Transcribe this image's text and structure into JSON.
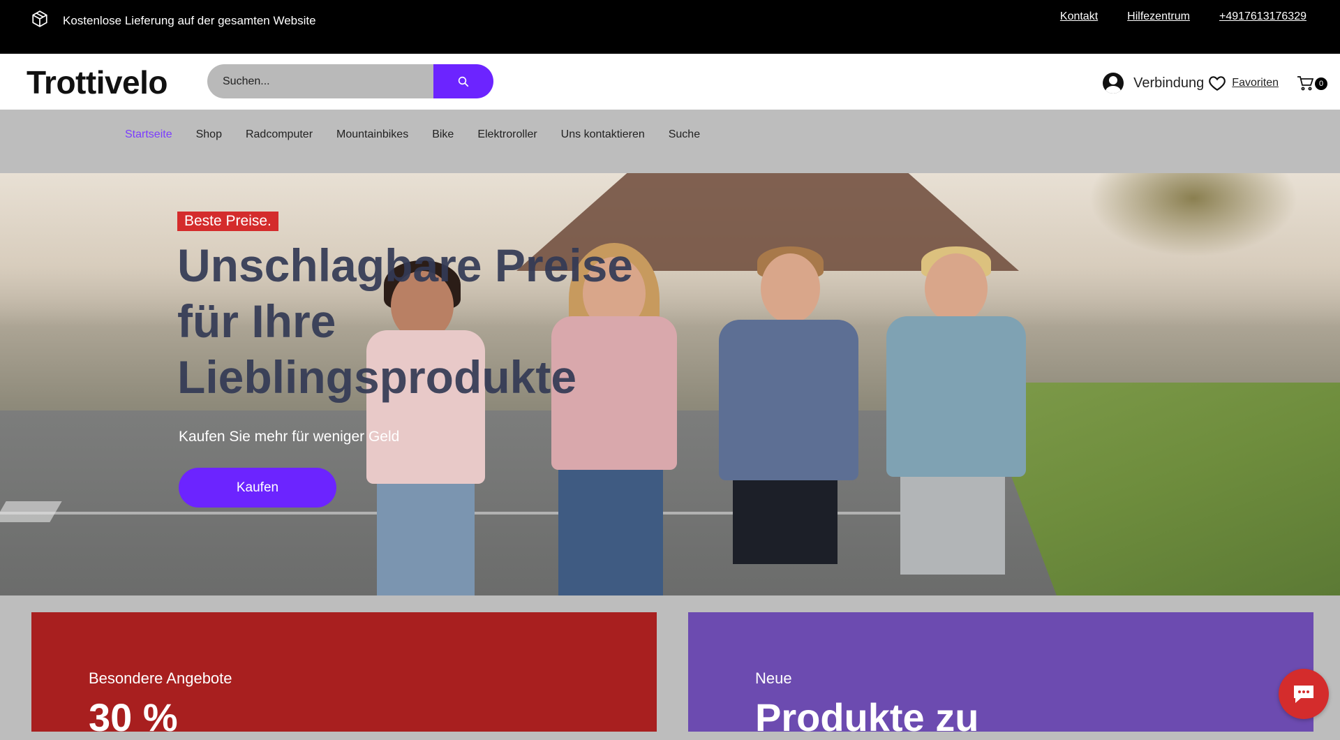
{
  "topbar": {
    "shipping_text": "Kostenlose Lieferung auf der gesamten Website",
    "links": [
      "Kontakt",
      "Hilfezentrum",
      "+4917613176329"
    ]
  },
  "header": {
    "logo": "Trottivelo",
    "search_placeholder": "Suchen...",
    "login_label": "Verbindung",
    "favorites_label": "Favoriten",
    "cart_count": "0"
  },
  "nav": {
    "items": [
      "Startseite",
      "Shop",
      "Radcomputer",
      "Mountainbikes",
      "Bike",
      "Elektroroller",
      "Uns kontaktieren",
      "Suche"
    ],
    "active_index": 0
  },
  "hero": {
    "badge": "Beste Preise.",
    "title": "Unschlagbare Preise für Ihre Lieblingsprodukte",
    "subtitle": "Kaufen Sie mehr für weniger Geld",
    "cta": "Kaufen"
  },
  "promos": [
    {
      "small": "Besondere Angebote",
      "big": "30 %",
      "color": "#a81f1f"
    },
    {
      "small": "Neue",
      "big": "Produkte zu",
      "color": "#6c4bb0"
    }
  ],
  "colors": {
    "accent": "#6c24ff",
    "active_nav": "#7b3cff",
    "badge_red": "#d42c2c"
  },
  "icons": {
    "shipping": "package-icon",
    "search": "search-icon",
    "user": "user-icon",
    "favorite": "heart-icon",
    "cart": "cart-icon",
    "chat": "chat-icon"
  }
}
